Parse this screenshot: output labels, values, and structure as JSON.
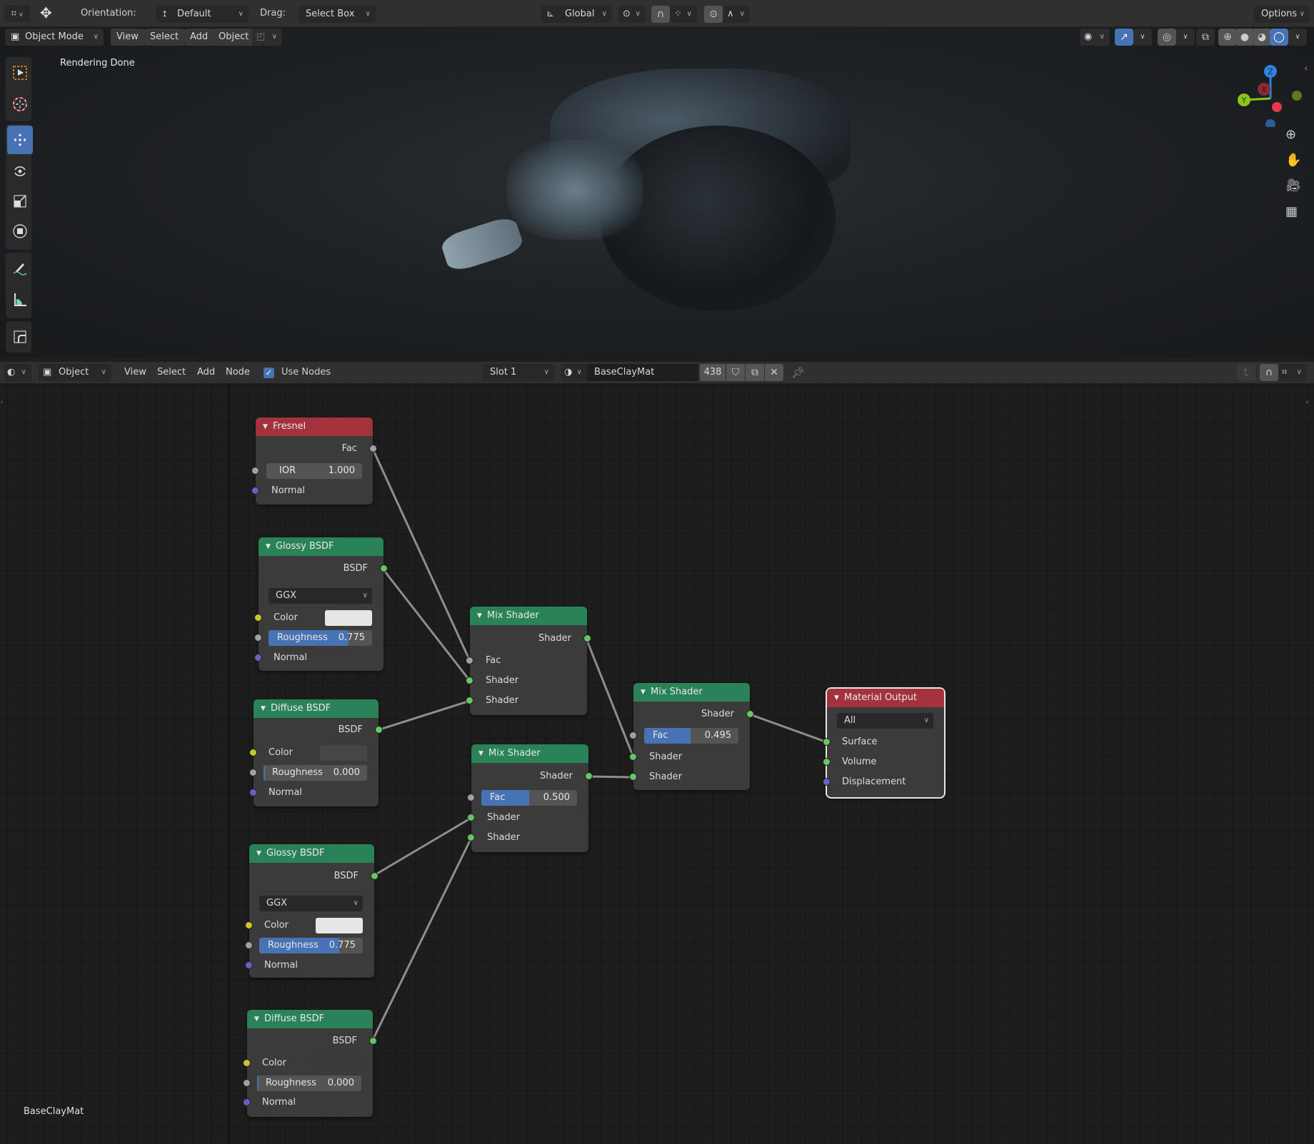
{
  "top_header": {
    "orientation_label": "Orientation:",
    "orientation_value": "Default",
    "drag_label": "Drag:",
    "drag_value": "Select Box",
    "transform_orientation": "Global",
    "options_label": "Options"
  },
  "viewport_header": {
    "mode": "Object Mode",
    "menus": [
      "View",
      "Select",
      "Add",
      "Object"
    ]
  },
  "viewport": {
    "status_text": "Rendering Done",
    "gizmo": {
      "x": "X",
      "y": "Y",
      "z": "Z"
    },
    "colors": {
      "x": "#e8394b",
      "y": "#8ac41d",
      "z": "#2f83e0"
    }
  },
  "node_header": {
    "object_type": "Object",
    "menus": [
      "View",
      "Select",
      "Add",
      "Node"
    ],
    "use_nodes_label": "Use Nodes",
    "use_nodes_checked": true,
    "slot": "Slot 1",
    "material_name": "BaseClayMat",
    "user_count": "438"
  },
  "node_editor": {
    "material_label": "BaseClayMat",
    "nodes": {
      "fresnel": {
        "title": "Fresnel",
        "out_fac": "Fac",
        "ior_label": "IOR",
        "ior_value": "1.000",
        "normal": "Normal"
      },
      "glossy1": {
        "title": "Glossy BSDF",
        "out": "BSDF",
        "distribution": "GGX",
        "color_label": "Color",
        "roughness_label": "Roughness",
        "roughness_value": "0.775",
        "roughness_fraction": 0.775,
        "normal": "Normal",
        "color": "#e6e6e6"
      },
      "diffuse1": {
        "title": "Diffuse BSDF",
        "out": "BSDF",
        "color_label": "Color",
        "roughness_label": "Roughness",
        "roughness_value": "0.000",
        "roughness_fraction": 0.0,
        "normal": "Normal",
        "color": "#464646"
      },
      "mix1": {
        "title": "Mix Shader",
        "out": "Shader",
        "fac_label": "Fac",
        "shader_a": "Shader",
        "shader_b": "Shader"
      },
      "mix2": {
        "title": "Mix Shader",
        "out": "Shader",
        "fac_label": "Fac",
        "fac_value": "0.500",
        "fac_fraction": 0.5,
        "shader_a": "Shader",
        "shader_b": "Shader"
      },
      "mix3": {
        "title": "Mix Shader",
        "out": "Shader",
        "fac_label": "Fac",
        "fac_value": "0.495",
        "fac_fraction": 0.495,
        "shader_a": "Shader",
        "shader_b": "Shader"
      },
      "output": {
        "title": "Material Output",
        "target": "All",
        "surface": "Surface",
        "volume": "Volume",
        "displacement": "Displacement"
      },
      "glossy2": {
        "title": "Glossy BSDF",
        "out": "BSDF",
        "distribution": "GGX",
        "color_label": "Color",
        "roughness_label": "Roughness",
        "roughness_value": "0.775",
        "roughness_fraction": 0.775,
        "normal": "Normal",
        "color": "#e6e6e6"
      },
      "diffuse2": {
        "title": "Diffuse BSDF",
        "out": "BSDF",
        "color_label": "Color",
        "roughness_label": "Roughness",
        "roughness_value": "0.000",
        "roughness_fraction": 0.0,
        "normal": "Normal",
        "color": "#3b3b3b"
      }
    }
  }
}
